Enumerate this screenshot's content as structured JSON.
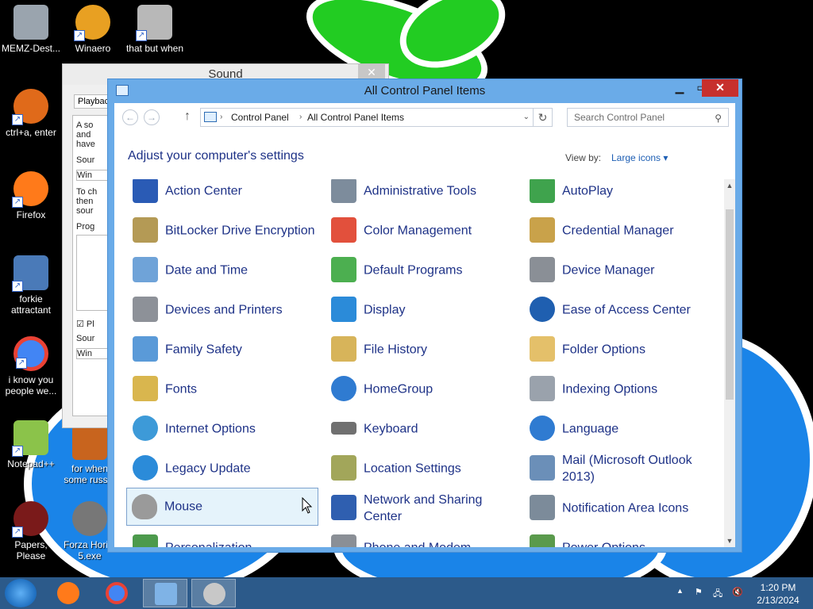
{
  "desktop": {
    "icons": [
      {
        "label": "MEMZ-Dest...",
        "color": "#9aa4ae"
      },
      {
        "label": "Winaero Tweaker",
        "color": "#e8a022"
      },
      {
        "label": "that but when",
        "color": "#b8b8b8"
      },
      {
        "label": "ctrl+a, enter",
        "color": "#e06a1a"
      },
      {
        "label": "Firefox",
        "color": "#ff7a1a"
      },
      {
        "label": "forkie attractant",
        "color": "#4a7ab8"
      },
      {
        "label": "i know you people we...",
        "color": "#4285f4"
      },
      {
        "label": "Notepad++",
        "color": "#8bc34a"
      },
      {
        "label": "for when some russ...",
        "color": "#c8641e"
      },
      {
        "label": "Papers, Please",
        "color": "#7a1a1a"
      },
      {
        "label": "Forza Hori... 5.exe",
        "color": "#777777"
      }
    ]
  },
  "sound_window": {
    "title": "Sound",
    "close_label": "✕",
    "tab_label": "Playbac",
    "body_lines": [
      "A so",
      "and",
      "have",
      "Sour",
      "Win",
      "To ch",
      "then",
      "sour",
      "Prog",
      "Pl",
      "Sour",
      "Win"
    ]
  },
  "window": {
    "title": "All Control Panel Items",
    "min_label": "▁",
    "max_label": "▭",
    "close_label": "✕"
  },
  "address": {
    "back": "←",
    "forward": "→",
    "up": "↑",
    "crumbs": [
      "Control Panel",
      "All Control Panel Items"
    ],
    "separator": "›",
    "dropdown": "⌄",
    "refresh": "↻"
  },
  "search": {
    "placeholder": "Search Control Panel",
    "icon": "⚲"
  },
  "heading": "Adjust your computer's settings",
  "viewby": {
    "label": "View by:",
    "value": "Large icons ▾"
  },
  "items": [
    {
      "label": "Action Center",
      "color": "#2a5bb5"
    },
    {
      "label": "Administrative Tools",
      "color": "#7d8c9c"
    },
    {
      "label": "AutoPlay",
      "color": "#3fa34d"
    },
    {
      "label": "BitLocker Drive Encryption",
      "color": "#b49a55"
    },
    {
      "label": "Color Management",
      "color": "#e2503c"
    },
    {
      "label": "Credential Manager",
      "color": "#c9a24a"
    },
    {
      "label": "Date and Time",
      "color": "#6fa3d8"
    },
    {
      "label": "Default Programs",
      "color": "#4caf50"
    },
    {
      "label": "Device Manager",
      "color": "#8a8f96"
    },
    {
      "label": "Devices and Printers",
      "color": "#8d9198"
    },
    {
      "label": "Display",
      "color": "#2b8bd9"
    },
    {
      "label": "Ease of Access Center",
      "color": "#1f5fb0"
    },
    {
      "label": "Family Safety",
      "color": "#5a9ad8"
    },
    {
      "label": "File History",
      "color": "#d7b45a"
    },
    {
      "label": "Folder Options",
      "color": "#e4c06a"
    },
    {
      "label": "Fonts",
      "color": "#d9b64e"
    },
    {
      "label": "HomeGroup",
      "color": "#2f7bd1"
    },
    {
      "label": "Indexing Options",
      "color": "#9aa2ac"
    },
    {
      "label": "Internet Options",
      "color": "#3d9ad8"
    },
    {
      "label": "Keyboard",
      "color": "#707070"
    },
    {
      "label": "Language",
      "color": "#2f7bd1"
    },
    {
      "label": "Legacy Update",
      "color": "#2b8bd9"
    },
    {
      "label": "Location Settings",
      "color": "#a2a65a"
    },
    {
      "label": "Mail (Microsoft Outlook 2013)",
      "color": "#6b8fb8"
    },
    {
      "label": "Mouse",
      "color": "#9a9a9a"
    },
    {
      "label": "Network and Sharing Center",
      "color": "#2f5fb0"
    },
    {
      "label": "Notification Area Icons",
      "color": "#7c8b9a"
    },
    {
      "label": "Personalization",
      "color": "#4c9a4c"
    },
    {
      "label": "Phone and Modem",
      "color": "#8a8f96"
    },
    {
      "label": "Power Options",
      "color": "#5a9a4c"
    }
  ],
  "scrollbar": {
    "up": "▲",
    "down": "▼"
  },
  "taskbar": {
    "apps": [
      {
        "name": "firefox",
        "color": "#ff7a1a"
      },
      {
        "name": "chrome",
        "color": "#4285f4"
      },
      {
        "name": "control-panel",
        "color": "#7fb3e6"
      },
      {
        "name": "sound",
        "color": "#c8c8c8"
      }
    ],
    "tray_icons": [
      "▲",
      "⚑",
      "🖧",
      "🔇"
    ],
    "time": "1:20 PM",
    "date": "2/13/2024"
  }
}
